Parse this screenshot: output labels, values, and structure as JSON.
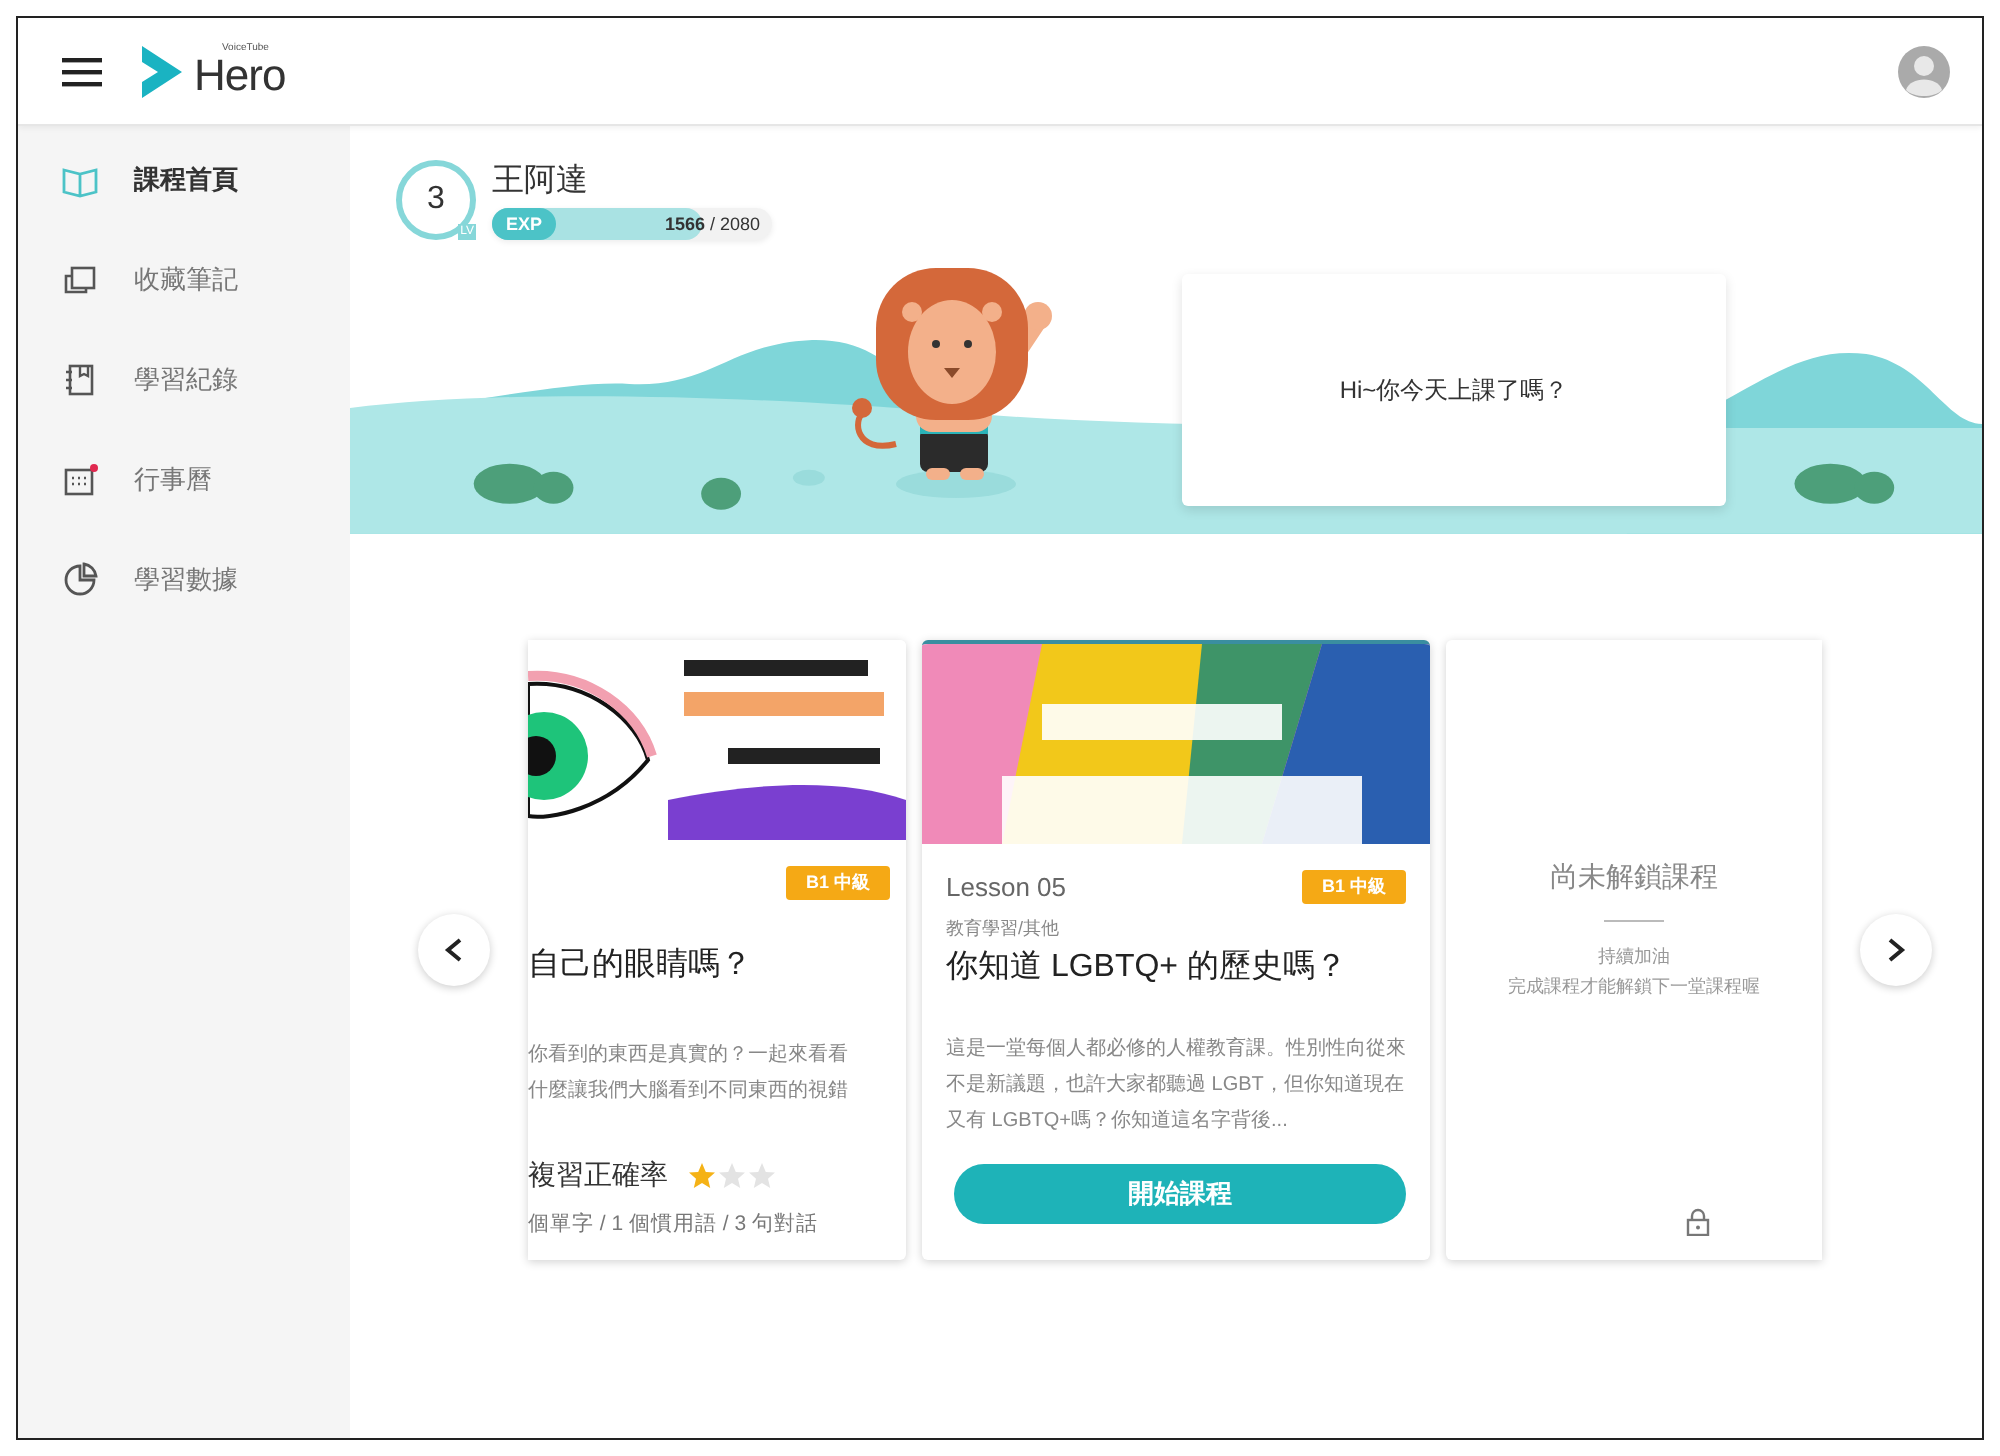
{
  "header": {
    "logo_small": "VoiceTube",
    "logo": "Hero"
  },
  "sidebar": {
    "items": [
      {
        "label": "課程首頁",
        "selected": true,
        "notification": false
      },
      {
        "label": "收藏筆記",
        "selected": false,
        "notification": false
      },
      {
        "label": "學習紀錄",
        "selected": false,
        "notification": false
      },
      {
        "label": "行事曆",
        "selected": false,
        "notification": true
      },
      {
        "label": "學習數據",
        "selected": false,
        "notification": false
      }
    ]
  },
  "profile": {
    "rank": "3",
    "rank_tag": "LV",
    "name": "王阿達",
    "exp": {
      "label": "EXP",
      "current": "1566",
      "total": "/ 2080",
      "level": 0.753
    }
  },
  "greeting": "Hi~你今天上課了嗎？",
  "cards": [
    {
      "kind": "partial",
      "badge": "B1 中級",
      "title": "自己的眼睛嗎？",
      "description_lines": [
        "你看到的東西是真實的？一起來看看",
        "什麼讓我們大腦看到不同東西的視錯"
      ],
      "rating": {
        "label": "複習正確率",
        "stars": 1
      },
      "summary": "個單字 / 1 個慣用語 / 3 句對話"
    },
    {
      "kind": "current",
      "lesson": "Lesson 05",
      "badge": "B1 中級",
      "category": "教育學習/其他",
      "title": "你知道 LGBTQ+ 的歷史嗎？",
      "description": "這是一堂每個人都必修的人權教育課。性別性向從來不是新議題，也許大家都聽過 LGBT，但你知道現在又有 LGBTQ+嗎？你知道這名字背後...",
      "button": "開始課程"
    },
    {
      "kind": "locked",
      "title": "尚未解鎖課程",
      "lines": [
        "持續加油",
        "完成課程才能解鎖下一堂課程喔"
      ]
    }
  ]
}
